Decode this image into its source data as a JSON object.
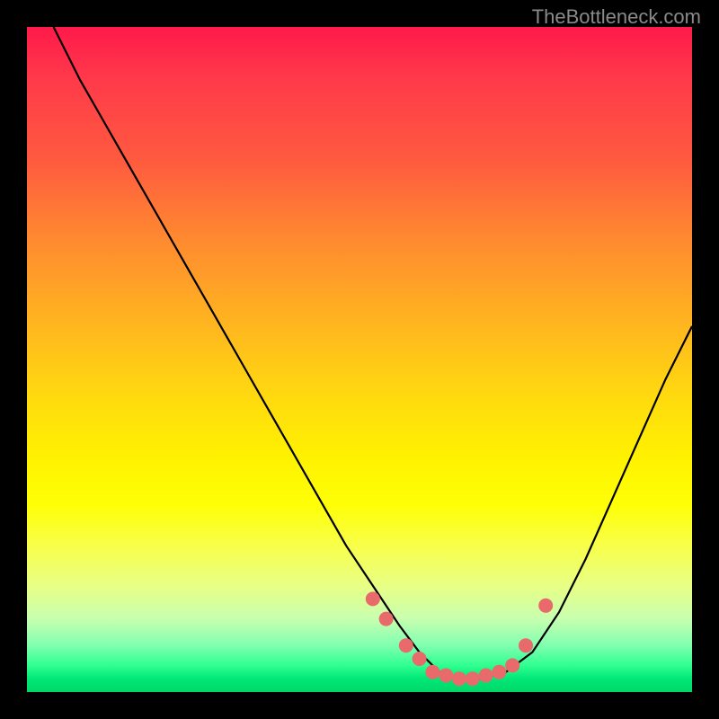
{
  "watermark": "TheBottleneck.com",
  "chart_data": {
    "type": "line",
    "title": "",
    "xlabel": "",
    "ylabel": "",
    "xlim": [
      0,
      100
    ],
    "ylim": [
      0,
      100
    ],
    "series": [
      {
        "name": "bottleneck-curve",
        "x": [
          4,
          8,
          12,
          16,
          20,
          24,
          28,
          32,
          36,
          40,
          44,
          48,
          52,
          56,
          59,
          62,
          65,
          68,
          72,
          76,
          80,
          84,
          88,
          92,
          96,
          100
        ],
        "y": [
          100,
          92,
          85,
          78,
          71,
          64,
          57,
          50,
          43,
          36,
          29,
          22,
          16,
          10,
          6,
          3,
          2,
          2,
          3,
          6,
          12,
          20,
          29,
          38,
          47,
          55
        ]
      },
      {
        "name": "data-points",
        "x": [
          52,
          54,
          57,
          59,
          61,
          63,
          65,
          67,
          69,
          71,
          73,
          75,
          78
        ],
        "y": [
          14,
          11,
          7,
          5,
          3,
          2.5,
          2,
          2,
          2.5,
          3,
          4,
          7,
          13
        ]
      }
    ]
  }
}
